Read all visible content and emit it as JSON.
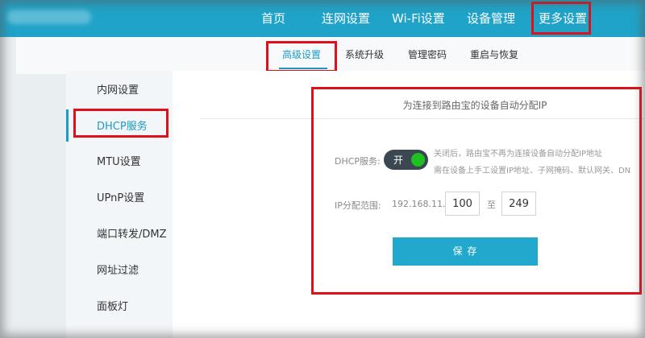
{
  "top_nav": {
    "items": [
      "首页",
      "连网设置",
      "Wi-Fi设置",
      "设备管理",
      "更多设置"
    ],
    "active_index": 4
  },
  "sub_nav": {
    "items": [
      "高级设置",
      "系统升级",
      "管理密码",
      "重启与恢复"
    ],
    "active_index": 0
  },
  "sidebar": {
    "items": [
      "内网设置",
      "DHCP服务",
      "MTU设置",
      "UPnP设置",
      "端口转发/DMZ",
      "网址过滤",
      "面板灯"
    ],
    "active_index": 1
  },
  "dhcp": {
    "section_title": "为连接到路由宝的设备自动分配IP",
    "service_label": "DHCP服务:",
    "toggle_text": "开",
    "toggle_on": true,
    "note_line1": "关闭后，路由宝不再为连接设备自动分配IP地址",
    "note_line2": "需在设备上手工设置IP地址、子网掩码、默认网关、DN",
    "range_label": "IP分配范围:",
    "ip_prefix": "192.168.11.",
    "range_start": "100",
    "range_separator": "至",
    "range_end": "249",
    "save_label": "保 存"
  },
  "colors": {
    "header": "#1fa3c8",
    "accent": "#1a9bc4",
    "highlight_box": "#e0101a",
    "toggle_on": "#1ec21e",
    "save_button": "#22a8cc"
  }
}
